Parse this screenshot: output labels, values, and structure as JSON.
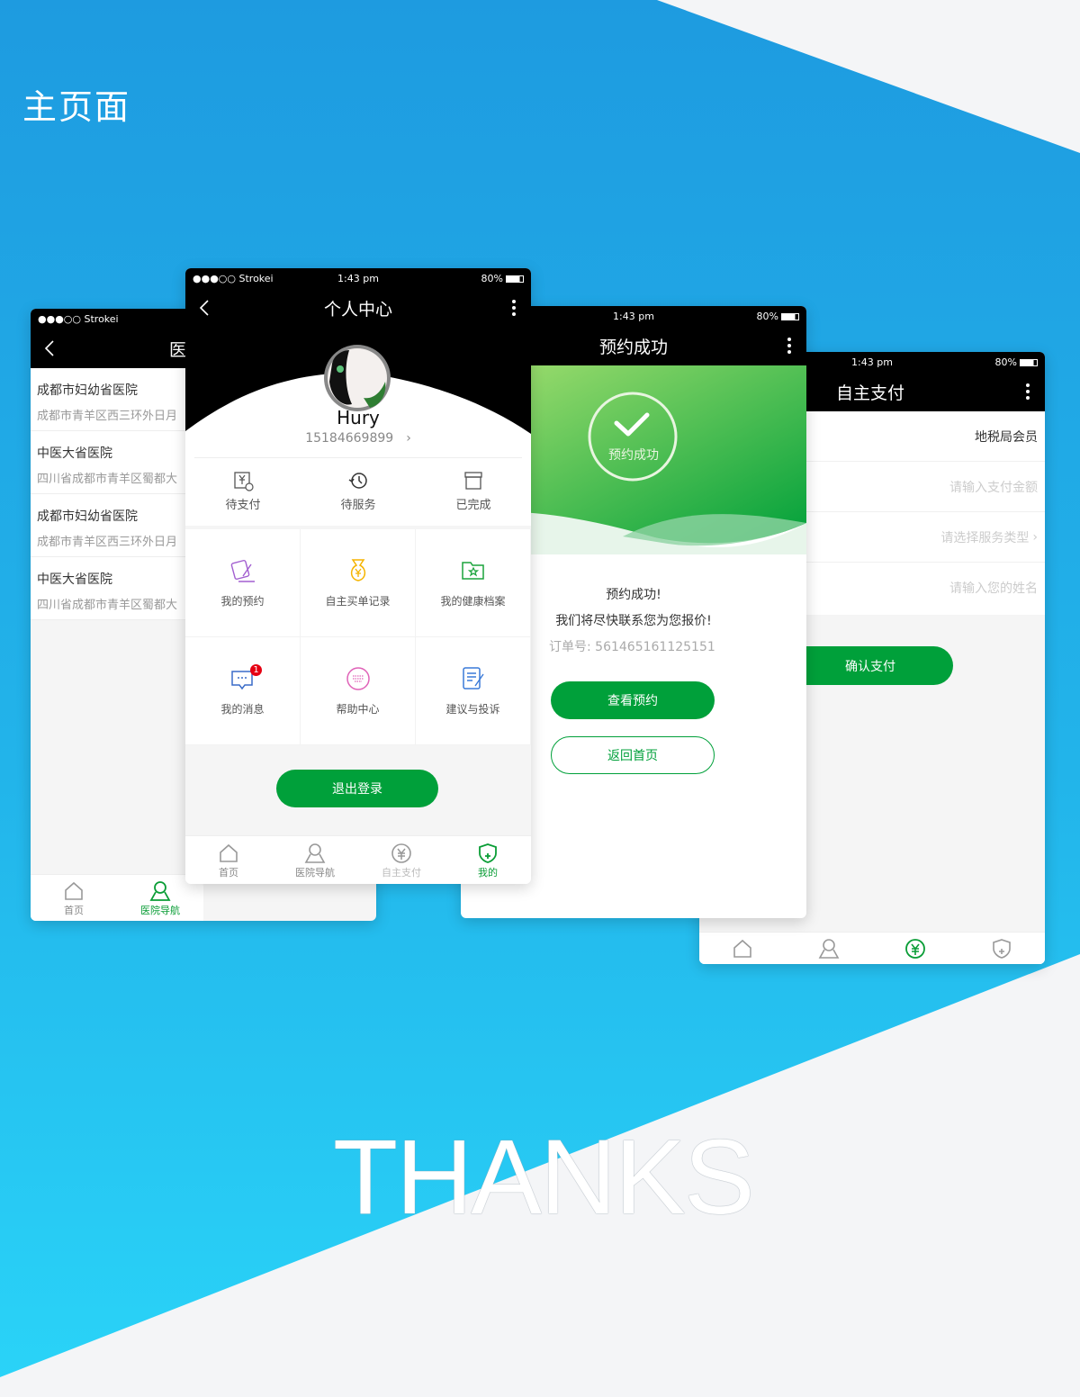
{
  "page": {
    "heading": "主页面",
    "footer": "THANKS"
  },
  "colors": {
    "brand_green": "#00a03a",
    "bg_blue": "#1e9be0",
    "header": "#000000"
  },
  "status": {
    "carrier": "●●●○○ Strokei",
    "time": "1:43 pm",
    "battery": "80%"
  },
  "nav": {
    "home": "首页",
    "hospital": "医院导航",
    "pay": "自主支付",
    "mine": "我的"
  },
  "hospital_screen": {
    "title": "医院导航",
    "items": [
      {
        "name": "成都市妇幼省医院",
        "address": "成都市青羊区西三环外日月"
      },
      {
        "name": "中医大省医院",
        "address": "四川省成都市青羊区蜀都大"
      },
      {
        "name": "成都市妇幼省医院",
        "address": "成都市青羊区西三环外日月"
      },
      {
        "name": "中医大省医院",
        "address": "四川省成都市青羊区蜀都大"
      }
    ]
  },
  "profile_screen": {
    "title": "个人中心",
    "name": "Hury",
    "phone": "15184669899",
    "orders": [
      {
        "label": "待支付",
        "icon": "yuan-clock-icon"
      },
      {
        "label": "待服务",
        "icon": "history-icon"
      },
      {
        "label": "已完成",
        "icon": "box-icon"
      }
    ],
    "grid": [
      {
        "label": "我的预约",
        "icon": "note-pen-icon",
        "color": "#a25fd0"
      },
      {
        "label": "自主买单记录",
        "icon": "money-bag-icon",
        "color": "#f5b400"
      },
      {
        "label": "我的健康档案",
        "icon": "folder-star-icon",
        "color": "#1aa33b"
      },
      {
        "label": "我的消息",
        "icon": "message-icon",
        "color": "#3a6cc8",
        "badge": "1"
      },
      {
        "label": "帮助中心",
        "icon": "keyboard-icon",
        "color": "#e063b8"
      },
      {
        "label": "建议与投诉",
        "icon": "document-edit-icon",
        "color": "#3a7ad8"
      }
    ],
    "logout": "退出登录"
  },
  "success_screen": {
    "title": "预约成功",
    "badge": "预约成功",
    "msg1": "预约成功!",
    "msg2": "我们将尽快联系您为您报价!",
    "order_label": "订单号:",
    "order_no": "561465161125151",
    "view": "查看预约",
    "home": "返回首页"
  },
  "pay_screen": {
    "title": "自主支付",
    "member": "地税局会员",
    "amount_placeholder": "请输入支付金额",
    "service_placeholder": "请选择服务类型",
    "name_placeholder": "请输入您的姓名",
    "confirm": "确认支付"
  }
}
